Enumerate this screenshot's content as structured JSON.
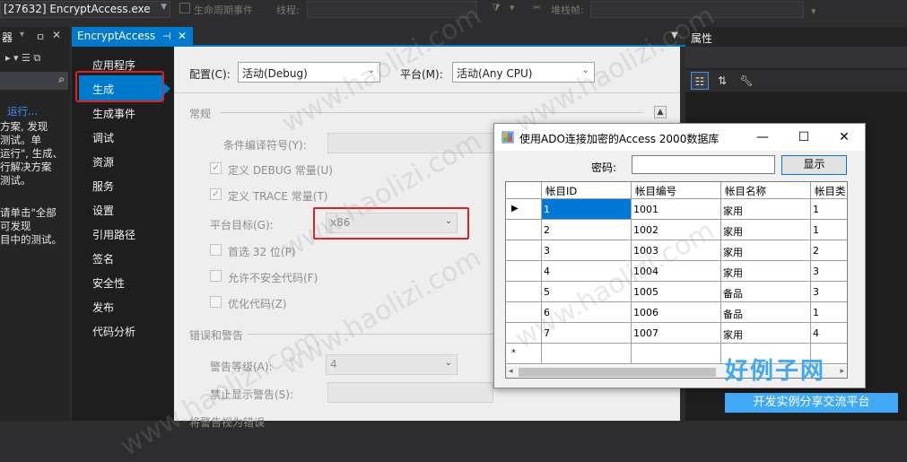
{
  "toolbar": {
    "process": "[27632] EncryptAccess.exe",
    "lifecycle_label": "生命周期事件",
    "thread_label": "线程:",
    "stackframe_label": "堆栈帧:"
  },
  "left_panel": {
    "header": "器",
    "run_label": "运行...",
    "text1": "方案, 发现\n测试。单\n运行\", 生成、\n行解决方案\n测试。",
    "text2": "请单击\"全部\n可发现\n目中的测试。"
  },
  "tab": {
    "label": "EncryptAccess"
  },
  "nav": {
    "items": [
      "应用程序",
      "生成",
      "生成事件",
      "调试",
      "资源",
      "服务",
      "设置",
      "引用路径",
      "签名",
      "安全性",
      "发布",
      "代码分析"
    ],
    "selected": "生成"
  },
  "props": {
    "config_label": "配置(C):",
    "config_value": "活动(Debug)",
    "platform_label": "平台(M):",
    "platform_value": "活动(Any CPU)",
    "general_section": "常规",
    "cond_symbols_label": "条件编译符号(Y):",
    "define_debug": "定义 DEBUG 常量(U)",
    "define_trace": "定义 TRACE 常量(T)",
    "platform_target_label": "平台目标(G):",
    "platform_target_value": "x86",
    "prefer32": "首选 32 位(P)",
    "unsafe": "允许不安全代码(F)",
    "optimize": "优化代码(Z)",
    "errors_section": "错误和警告",
    "warning_level_label": "警告等级(A):",
    "warning_level_value": "4",
    "suppress_label": "禁止显示警告(S):",
    "treat_section": "将警告视为错误"
  },
  "right_pane": {
    "title": "属性"
  },
  "dialog": {
    "title": "使用ADO连接加密的Access 2000数据库",
    "password_label": "密码:",
    "show_button": "显示",
    "columns": [
      "帐目ID",
      "帐目编号",
      "帐目名称",
      "帐目类"
    ],
    "rows": [
      [
        "1",
        "1001",
        "家用",
        "1"
      ],
      [
        "2",
        "1002",
        "家用",
        "1"
      ],
      [
        "3",
        "1003",
        "家用",
        "2"
      ],
      [
        "4",
        "1004",
        "家用",
        "3"
      ],
      [
        "5",
        "1005",
        "备品",
        "3"
      ],
      [
        "6",
        "1006",
        "备品",
        "1"
      ],
      [
        "7",
        "1007",
        "家用",
        "4"
      ]
    ],
    "current_row_marker": "▶",
    "new_row_marker": "*"
  },
  "watermark": {
    "logo": "好例子网",
    "tagline": "开发实例分享交流平台",
    "site": "www.haolizi.com"
  },
  "colors": {
    "vs_accent": "#007acc",
    "highlight_red": "#e02020",
    "selected_cell": "#0078d7"
  }
}
